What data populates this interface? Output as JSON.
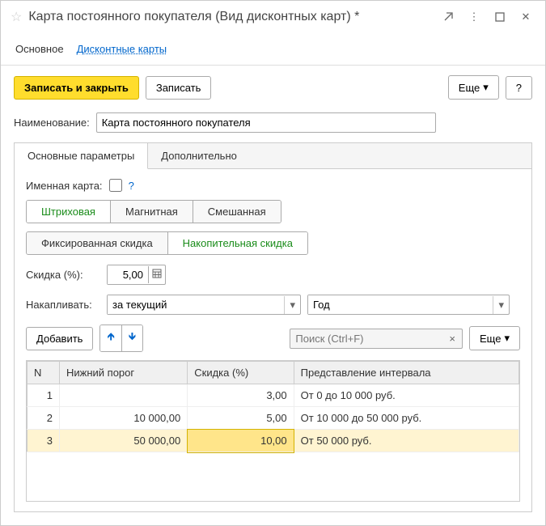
{
  "window": {
    "title": "Карта постоянного покупателя (Вид дисконтных карт) *"
  },
  "nav": {
    "tab_main": "Основное",
    "tab_cards": "Дисконтные карты"
  },
  "toolbar": {
    "save_close": "Записать и закрыть",
    "save": "Записать",
    "more": "Еще",
    "help": "?"
  },
  "form": {
    "name_label": "Наименование:",
    "name_value": "Карта постоянного покупателя"
  },
  "panel": {
    "tab_params": "Основные параметры",
    "tab_extra": "Дополнительно"
  },
  "named_card": {
    "label": "Именная карта:",
    "help": "?"
  },
  "cardtype": {
    "barcode": "Штриховая",
    "magnetic": "Магнитная",
    "mixed": "Смешанная"
  },
  "discounttype": {
    "fixed": "Фиксированная скидка",
    "accum": "Накопительная скидка"
  },
  "discount": {
    "label": "Скидка (%):",
    "value": "5,00"
  },
  "accumulate": {
    "label": "Накапливать:",
    "period_value": "за текущий",
    "unit_value": "Год"
  },
  "tabletb": {
    "add": "Добавить",
    "search_placeholder": "Поиск (Ctrl+F)",
    "more": "Еще"
  },
  "grid": {
    "col_n": "N",
    "col_threshold": "Нижний порог",
    "col_discount": "Скидка (%)",
    "col_interval": "Представление интервала",
    "rows": [
      {
        "n": "1",
        "threshold": "",
        "discount": "3,00",
        "interval": "От 0 до 10 000 руб."
      },
      {
        "n": "2",
        "threshold": "10 000,00",
        "discount": "5,00",
        "interval": "От 10 000 до 50 000 руб."
      },
      {
        "n": "3",
        "threshold": "50 000,00",
        "discount": "10,00",
        "interval": "От 50 000 руб."
      }
    ]
  }
}
